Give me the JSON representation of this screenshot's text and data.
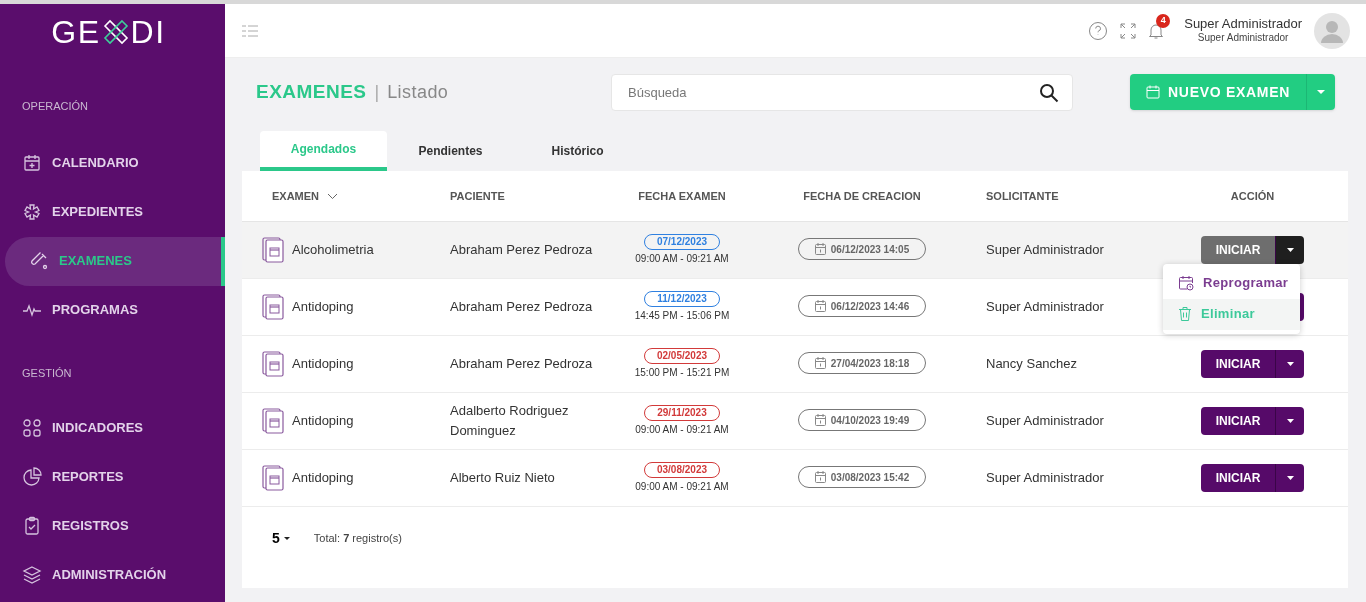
{
  "logo": {
    "left": "GE",
    "right": "DI"
  },
  "sidebar": {
    "sections": [
      {
        "title": "OPERACIÓN",
        "items": [
          {
            "label": "CALENDARIO",
            "selected": false
          },
          {
            "label": "EXPEDIENTES",
            "selected": false
          },
          {
            "label": "EXAMENES",
            "selected": true
          },
          {
            "label": "PROGRAMAS",
            "selected": false
          }
        ]
      },
      {
        "title": "GESTIÓN",
        "items": [
          {
            "label": "INDICADORES",
            "selected": false
          },
          {
            "label": "REPORTES",
            "selected": false
          },
          {
            "label": "REGISTROS",
            "selected": false
          },
          {
            "label": "ADMINISTRACIÓN",
            "selected": false
          }
        ]
      }
    ]
  },
  "header": {
    "notifications": "4",
    "user_name": "Super Administrador",
    "user_role": "Super Administrador"
  },
  "page": {
    "title": "EXAMENES",
    "separator": "|",
    "subtitle": "Listado",
    "search_placeholder": "Búsqueda",
    "new_button": "NUEVO EXAMEN"
  },
  "tabs": [
    {
      "label": "Agendados",
      "selected": true
    },
    {
      "label": "Pendientes",
      "selected": false
    },
    {
      "label": "Histórico",
      "selected": false
    }
  ],
  "table": {
    "columns": [
      "EXAMEN",
      "PACIENTE",
      "FECHA EXAMEN",
      "FECHA DE CREACION",
      "SOLICITANTE",
      "ACCIÓN"
    ],
    "rows": [
      {
        "exam": "Alcoholimetria",
        "patient": "Abraham Perez Pedroza",
        "date": "07/12/2023",
        "time": "09:00 AM - 09:21 AM",
        "color": "#2f80e0",
        "created": "06/12/2023 14:05",
        "requester": "Super Administrador",
        "action": "INICIAR",
        "menu_open": true,
        "selected": true
      },
      {
        "exam": "Antidoping",
        "patient": "Abraham Perez Pedroza",
        "date": "11/12/2023",
        "time": "14:45 PM - 15:06 PM",
        "color": "#2f80e0",
        "created": "06/12/2023 14:46",
        "requester": "Super Administrador",
        "menu_open": false,
        "selected": false
      },
      {
        "exam": "Antidoping",
        "patient": "Abraham Perez Pedroza",
        "date": "02/05/2023",
        "time": "15:00 PM - 15:21 PM",
        "color": "#d23a3a",
        "created": "27/04/2023 18:18",
        "requester": "Nancy Sanchez",
        "action": "INICIAR",
        "menu_open": false,
        "selected": false
      },
      {
        "exam": "Antidoping",
        "patient": "Adalberto Rodriguez Dominguez",
        "date": "29/11/2023",
        "time": "09:00 AM - 09:21 AM",
        "color": "#d23a3a",
        "created": "04/10/2023 19:49",
        "requester": "Super Administrador",
        "action": "INICIAR",
        "menu_open": false,
        "selected": false
      },
      {
        "exam": "Antidoping",
        "patient": "Alberto Ruiz Nieto",
        "date": "03/08/2023",
        "time": "09:00 AM - 09:21 AM",
        "color": "#d23a3a",
        "created": "03/08/2023 15:42",
        "requester": "Super Administrador",
        "action": "INICIAR",
        "menu_open": false,
        "selected": false
      }
    ]
  },
  "action_menu": [
    {
      "label": "Reprogramar",
      "kind": "reschedule",
      "selected": false
    },
    {
      "label": "Eliminar",
      "kind": "delete",
      "selected": true
    }
  ],
  "footer": {
    "page_size": "5",
    "total": "Total: **7** registro(s)"
  }
}
